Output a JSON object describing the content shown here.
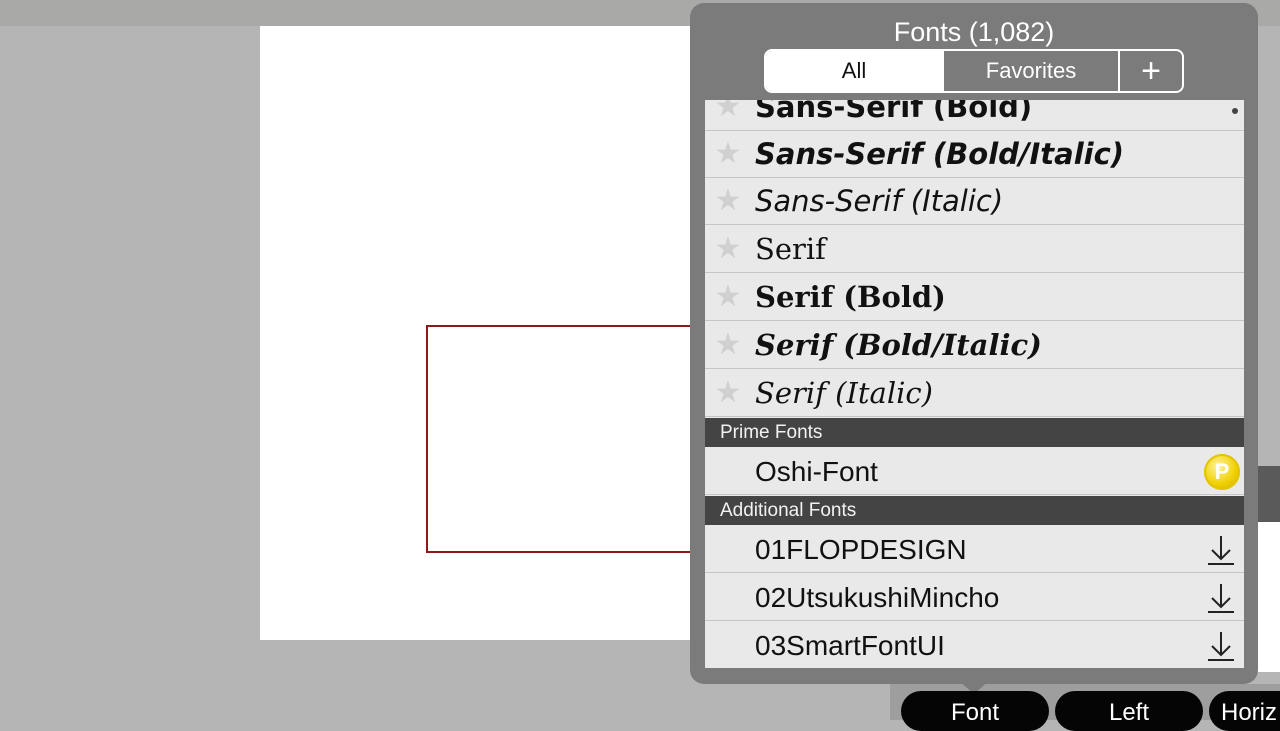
{
  "panel": {
    "title": "Fonts (1,082)",
    "tabs": {
      "all": "All",
      "favorites": "Favorites",
      "add": "+"
    }
  },
  "fonts": {
    "standard": [
      {
        "label": "Sans-Serif (Bold)",
        "icon": "star-icon"
      },
      {
        "label": "Sans-Serif (Bold/Italic)",
        "icon": "star-icon"
      },
      {
        "label": "Sans-Serif (Italic)",
        "icon": "star-icon"
      },
      {
        "label": "Serif",
        "icon": "star-icon"
      },
      {
        "label": "Serif (Bold)",
        "icon": "star-icon"
      },
      {
        "label": "Serif (Bold/Italic)",
        "icon": "star-icon"
      },
      {
        "label": "Serif (Italic)",
        "icon": "star-icon"
      }
    ],
    "prime_header": "Prime Fonts",
    "prime": [
      {
        "label": "Oshi-Font",
        "badge": "P"
      }
    ],
    "additional_header": "Additional Fonts",
    "additional": [
      {
        "label": "01FLOPDESIGN",
        "icon": "download-icon"
      },
      {
        "label": "02UtsukushiMincho",
        "icon": "download-icon"
      },
      {
        "label": "03SmartFontUI",
        "icon": "download-icon"
      }
    ]
  },
  "toolbar": {
    "font": "Font",
    "left": "Left",
    "horizontal": "Horiz"
  },
  "colors": {
    "selection": "#8b1a1a",
    "panel": "#7b7b7b",
    "badge": "#f0d000"
  }
}
